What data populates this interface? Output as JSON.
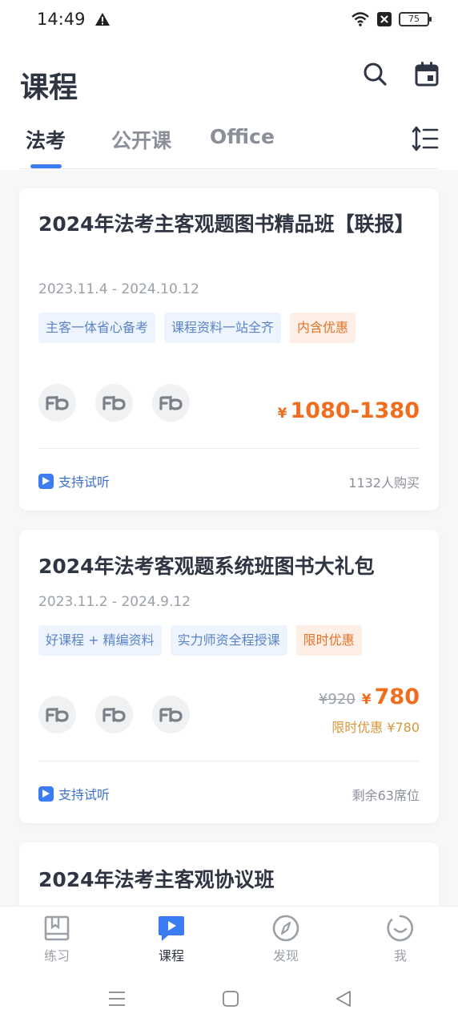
{
  "status": {
    "time": "14:49",
    "battery": "75"
  },
  "header": {
    "title": "课程",
    "search_icon": "search-icon",
    "calendar_icon": "calendar-icon"
  },
  "tabs": [
    {
      "label": "法考",
      "active": true
    },
    {
      "label": "公开课",
      "active": false
    },
    {
      "label": "Office",
      "active": false
    }
  ],
  "courses": [
    {
      "title": "2024年法考主客观题图书精品班【联报】",
      "date": "2023.11.4 - 2024.10.12",
      "tags": [
        "主客一体省心备考",
        "课程资料一站全齐",
        "内含优惠"
      ],
      "yen": "¥",
      "price": "1080-1380",
      "trial": "支持试听",
      "meta": "1132人购买"
    },
    {
      "title": "2024年法考客观题系统班图书大礼包",
      "date": "2023.11.2 - 2024.9.12",
      "tags": [
        "好课程 + 精编资料",
        "实力师资全程授课",
        "限时优惠"
      ],
      "orig_price": "¥920",
      "yen": "¥",
      "price": "780",
      "limit": "限时优惠 ¥780",
      "trial": "支持试听",
      "meta": "剩余63席位"
    },
    {
      "title": "2024年法考主客观协议班"
    }
  ],
  "nav": [
    {
      "label": "练习",
      "icon": "book-icon"
    },
    {
      "label": "课程",
      "icon": "play-chat-icon",
      "active": true
    },
    {
      "label": "发现",
      "icon": "compass-icon"
    },
    {
      "label": "我",
      "icon": "smile-icon"
    }
  ],
  "colors": {
    "accent": "#3b7cf2",
    "price": "#f06d1e",
    "text": "#2f3542"
  }
}
